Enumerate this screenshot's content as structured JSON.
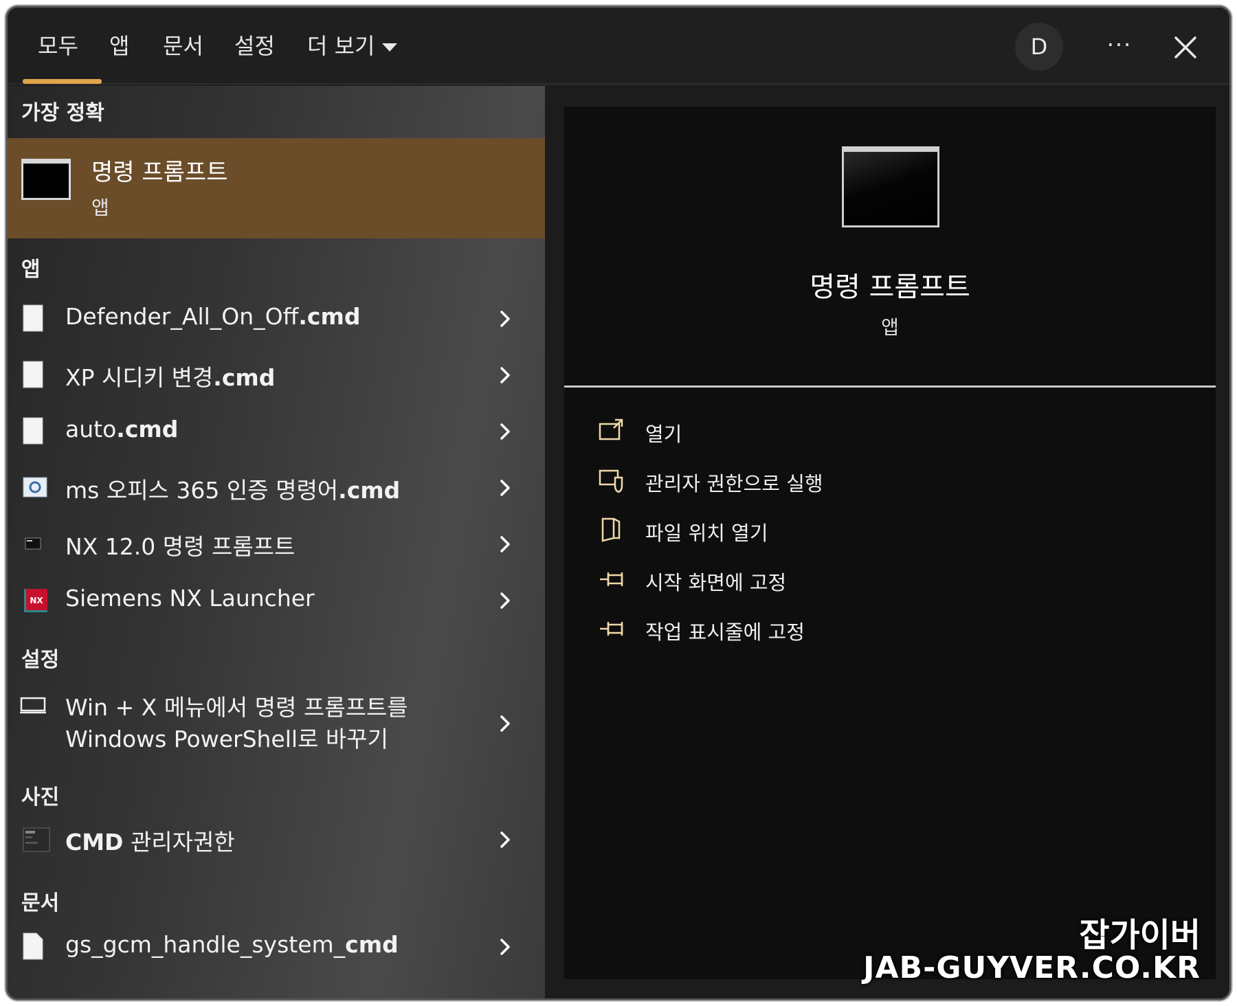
{
  "tabs": [
    {
      "label": "모두",
      "active": true
    },
    {
      "label": "앱"
    },
    {
      "label": "문서"
    },
    {
      "label": "설정"
    },
    {
      "label": "더 보기"
    }
  ],
  "header": {
    "avatar_initial": "D",
    "more_label": "···",
    "accent_color": "#e2a44a"
  },
  "sections": {
    "best_match": "가장 정확",
    "apps": "앱",
    "settings": "설정",
    "photos": "사진",
    "documents": "문서"
  },
  "best_match": {
    "title": "명령 프롬프트",
    "subtitle": "앱",
    "icon": "command-prompt-icon",
    "highlight_color": "#6b4d2a"
  },
  "apps": [
    {
      "name": "Defender_All_On_Off",
      "ext": ".cmd",
      "icon": "file-icon"
    },
    {
      "name": "XP 시디키 변경",
      "ext": ".cmd",
      "icon": "file-icon"
    },
    {
      "name": "auto",
      "ext": ".cmd",
      "icon": "file-icon"
    },
    {
      "name": "ms 오피스 365 인증 명령어",
      "ext": ".cmd",
      "icon": "settings-file-icon"
    },
    {
      "name": "NX 12.0 명령 프롬프트",
      "ext": "",
      "icon": "terminal-icon"
    },
    {
      "name": "Siemens NX Launcher",
      "ext": "",
      "icon": "nx-icon"
    }
  ],
  "settings_item": {
    "line1": "Win + X 메뉴에서 명령 프롬프트를",
    "line2": "Windows PowerShell로 바꾸기",
    "icon": "laptop-icon"
  },
  "photo_item": {
    "bold": "CMD",
    "rest": " 관리자권한",
    "icon": "photo-thumbnail-icon"
  },
  "document_item": {
    "name": "gs_gcm_handle_system_",
    "bold": "cmd",
    "icon": "file-icon"
  },
  "detail": {
    "title": "명령 프롬프트",
    "subtitle": "앱",
    "actions": [
      {
        "label": "열기",
        "icon": "open-icon"
      },
      {
        "label": "관리자 권한으로 실행",
        "icon": "shield-icon"
      },
      {
        "label": "파일 위치 열기",
        "icon": "folder-icon"
      },
      {
        "label": "시작 화면에 고정",
        "icon": "pin-icon"
      },
      {
        "label": "작업 표시줄에 고정",
        "icon": "pin-icon"
      }
    ]
  },
  "watermark": {
    "line1": "잡가이버",
    "line2": "JAB-GUYVER.CO.KR"
  }
}
